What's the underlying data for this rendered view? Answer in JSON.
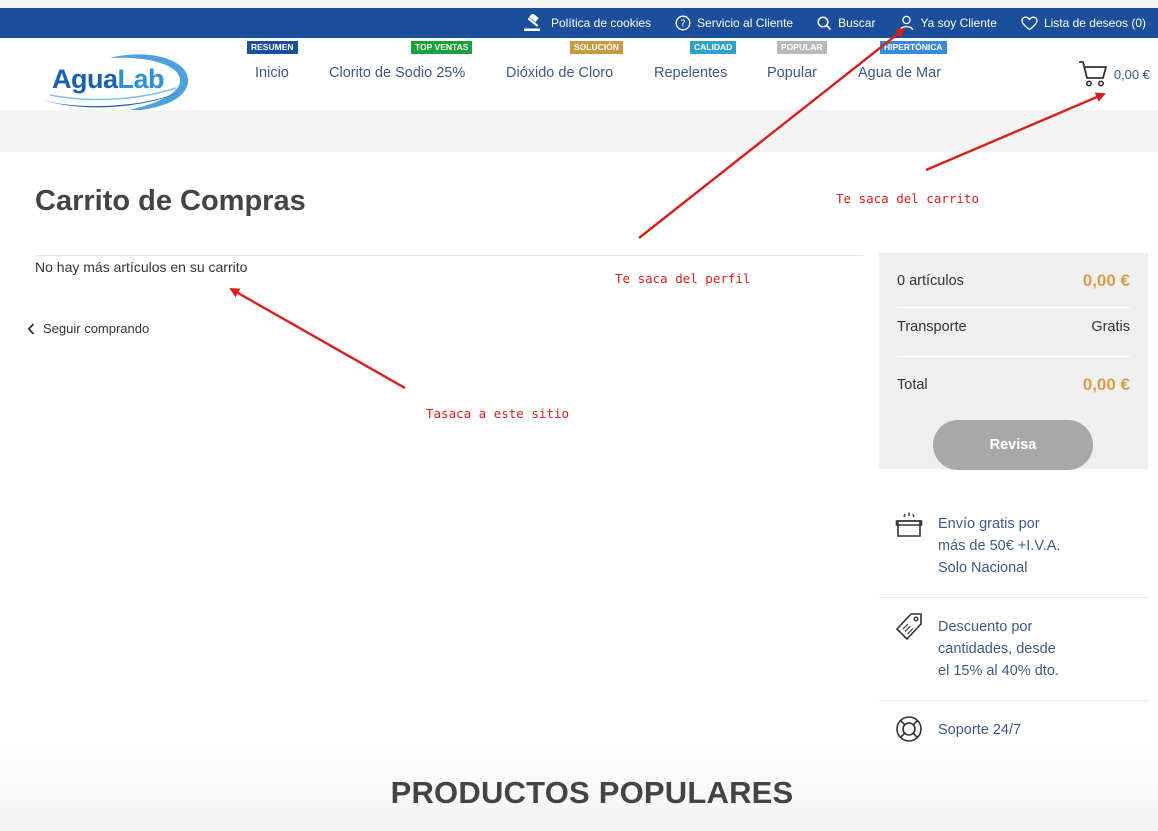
{
  "topbar": {
    "items": [
      {
        "label": "Política de cookies",
        "icon": "gavel-icon"
      },
      {
        "label": "Servicio al Cliente",
        "icon": "help-circle-icon"
      },
      {
        "label": "Buscar",
        "icon": "search-icon"
      },
      {
        "label": "Ya soy Cliente",
        "icon": "user-icon"
      },
      {
        "label": "Lista de deseos (0)",
        "icon": "heart-icon"
      }
    ]
  },
  "header": {
    "logo": {
      "part1": "Agua",
      "part2": "Lab"
    },
    "nav": [
      {
        "label": "Inicio",
        "badge": "RESUMEN",
        "badge_color": "#1b4f9c"
      },
      {
        "label": "Clorito de Sodio 25%",
        "badge": "TOP VENTAS",
        "badge_color": "#19a23b"
      },
      {
        "label": "Dióxido de Cloro",
        "badge": "SOLUCIÓN",
        "badge_color": "#c99a3e"
      },
      {
        "label": "Repelentes",
        "badge": "CALIDAD",
        "badge_color": "#2fa2c9"
      },
      {
        "label": "Popular",
        "badge": "POPULAR",
        "badge_color": "#b9b9b9"
      },
      {
        "label": "Agua de Mar",
        "badge": "HIPERTÓNICA",
        "badge_color": "#3b8ad6"
      }
    ],
    "cart_total": "0,00 €"
  },
  "cart": {
    "title": "Carrito de Compras",
    "empty_message": "No hay más artículos en su carrito",
    "continue_label": "Seguir comprando"
  },
  "summary": {
    "items_label": "0 artículos",
    "items_value": "0,00 €",
    "shipping_label": "Transporte",
    "shipping_value": "Gratis",
    "total_label": "Total",
    "total_value": "0,00 €",
    "checkout_label": "Revisa"
  },
  "features": [
    {
      "icon": "box-icon",
      "lines": [
        "Envío gratis por",
        "más de 50€ +I.V.A.",
        "Solo Nacional"
      ]
    },
    {
      "icon": "tag-icon",
      "lines": [
        "Descuento por",
        "cantidades, desde",
        "el 15% al 40% dto."
      ]
    },
    {
      "icon": "lifebuoy-icon",
      "lines": [
        "Soporte 24/7"
      ]
    }
  ],
  "popular": {
    "title": "PRODUCTOS POPULARES"
  },
  "annotations": {
    "cart_note": "Te saca del carrito",
    "profile_note": "Te saca del perfil",
    "site_note": "Tasaca a este sitio"
  },
  "colors": {
    "brand_blue": "#1b4f9c",
    "accent_gold": "#d1a04a",
    "annotation_red": "#d6201c"
  }
}
